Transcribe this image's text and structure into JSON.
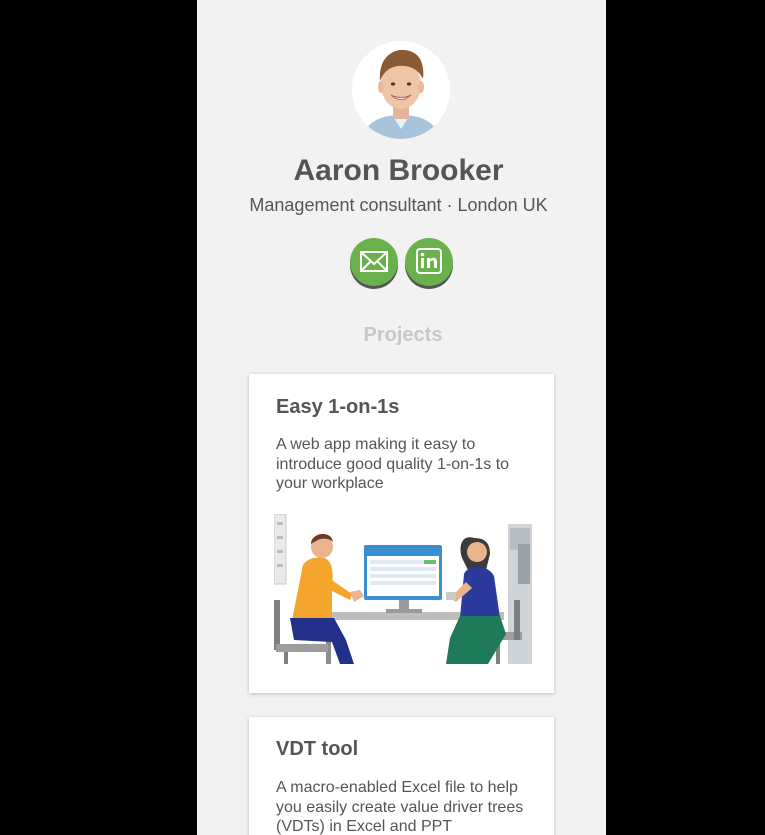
{
  "profile": {
    "name": "Aaron Brooker",
    "tagline": "Management consultant · London UK"
  },
  "social": {
    "email_icon": "mail-icon",
    "linkedin_icon": "linkedin-icon",
    "button_color": "#6ab04c"
  },
  "projects": {
    "section_title": "Projects",
    "items": [
      {
        "title": "Easy 1-on-1s",
        "description": "A web app making it easy to introduce good quality 1-on-1s to your workplace",
        "image": "meeting-illustration"
      },
      {
        "title": "VDT tool",
        "description": "A macro-enabled Excel file to help you easily create value driver trees (VDTs) in Excel and PPT"
      }
    ]
  }
}
